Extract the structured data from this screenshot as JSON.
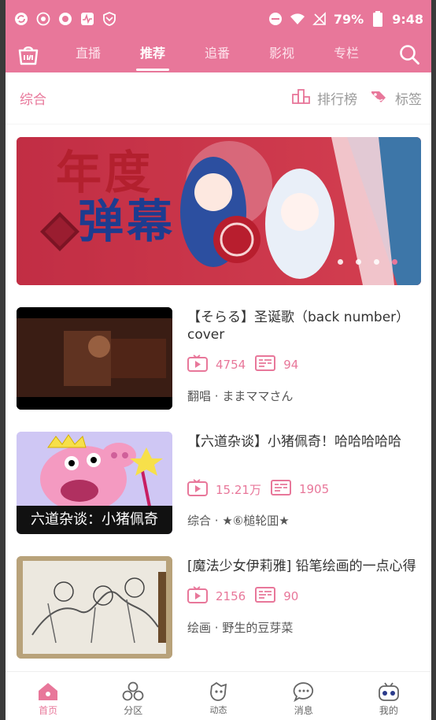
{
  "statusbar": {
    "battery": "79%",
    "time": "9:48"
  },
  "header": {
    "tabs": [
      {
        "label": "直播"
      },
      {
        "label": "推荐"
      },
      {
        "label": "追番"
      },
      {
        "label": "影视"
      },
      {
        "label": "专栏"
      }
    ],
    "active_tab": "推荐"
  },
  "subheader": {
    "category": "综合",
    "ranking_label": "排行榜",
    "tags_label": "标签"
  },
  "banner": {
    "headline_line1": "年度",
    "headline_line2": "弹幕",
    "dots": 4,
    "active_dot": 3
  },
  "videos": [
    {
      "title": "【そらる】圣诞歌（back number）cover",
      "plays": "4754",
      "danmaku": "94",
      "category": "翻唱",
      "author": "ままママさん"
    },
    {
      "title": "【六道杂谈】小猪佩奇！哈哈哈哈哈",
      "plays": "15.21万",
      "danmaku": "1905",
      "category": "综合",
      "author": "★⑥槌轮囬★",
      "thumb_caption": "六道杂谈：小猪佩奇"
    },
    {
      "title": "[魔法少女伊莉雅] 铅笔绘画的一点心得",
      "plays": "2156",
      "danmaku": "90",
      "category": "绘画",
      "author": "野生的豆芽菜"
    }
  ],
  "bottomnav": [
    {
      "label": "首页",
      "icon": "home-icon"
    },
    {
      "label": "分区",
      "icon": "category-icon"
    },
    {
      "label": "动态",
      "icon": "dynamic-icon"
    },
    {
      "label": "消息",
      "icon": "message-icon"
    },
    {
      "label": "我的",
      "icon": "profile-icon"
    }
  ],
  "colors": {
    "accent": "#e8779a"
  }
}
